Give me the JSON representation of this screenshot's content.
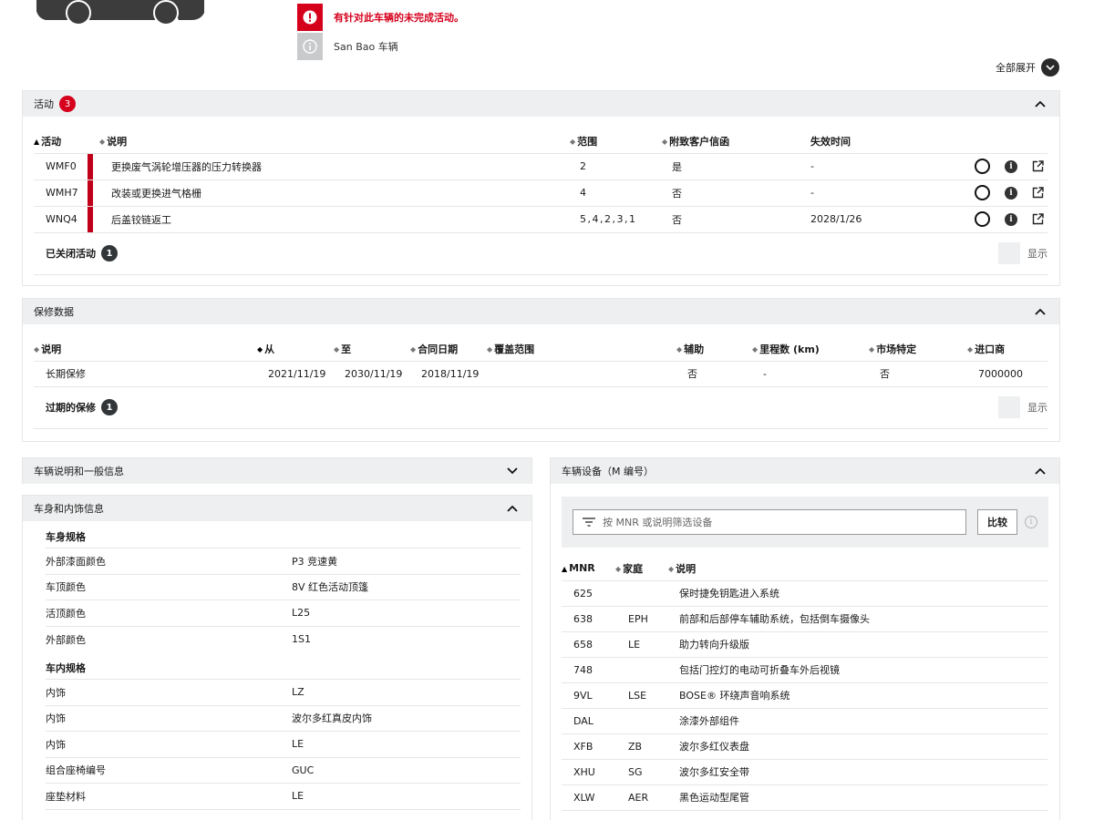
{
  "alerts": {
    "open_campaigns": "有针对此车辆的未完成活动。",
    "vehicle_type": "San Bao 车辆"
  },
  "expand_all": "全部展开",
  "campaigns": {
    "title": "活动",
    "count": "3",
    "headers": [
      "活动",
      "说明",
      "范围",
      "附致客户信函",
      "失效时间"
    ],
    "rows": [
      {
        "code": "WMF0",
        "desc": "更换废气涡轮增压器的压力转换器",
        "scope": "2",
        "letter": "是",
        "expiry": "-"
      },
      {
        "code": "WMH7",
        "desc": "改装或更换进气格栅",
        "scope": "4",
        "letter": "否",
        "expiry": "-"
      },
      {
        "code": "WNQ4",
        "desc": "后盖铰链返工",
        "scope": "5,4,2,3,1",
        "letter": "否",
        "expiry": "2028/1/26"
      }
    ],
    "closed_label": "已关闭活动",
    "closed_count": "1",
    "show_label": "显示"
  },
  "warranty": {
    "title": "保修数据",
    "headers": [
      "说明",
      "从",
      "至",
      "合同日期",
      "覆盖范围",
      "辅助",
      "里程数 (km)",
      "市场特定",
      "进口商"
    ],
    "rows": [
      {
        "desc": "长期保修",
        "from": "2021/11/19",
        "to": "2030/11/19",
        "contract": "2018/11/19",
        "coverage": "",
        "aux": "否",
        "mileage": "-",
        "market": "否",
        "importer": "7000000"
      }
    ],
    "expired_label": "过期的保修",
    "expired_count": "1",
    "show_label": "显示"
  },
  "general_info": {
    "title": "车辆说明和一般信息"
  },
  "body_interior": {
    "title": "车身和内饰信息",
    "body_spec_title": "车身规格",
    "body_spec": [
      {
        "k": "外部漆面颜色",
        "v": "P3 竞速黄"
      },
      {
        "k": "车顶颜色",
        "v": "8V 红色活动顶篷"
      },
      {
        "k": "活顶颜色",
        "v": "L25"
      },
      {
        "k": "外部颜色",
        "v": "1S1"
      }
    ],
    "interior_spec_title": "车内规格",
    "interior_spec": [
      {
        "k": "内饰",
        "v": "LZ"
      },
      {
        "k": "内饰",
        "v": "波尔多红真皮内饰"
      },
      {
        "k": "内饰",
        "v": "LE"
      },
      {
        "k": "组合座椅编号",
        "v": "GUC"
      },
      {
        "k": "座垫材料",
        "v": "LE"
      }
    ]
  },
  "equipment": {
    "title": "车辆设备（M 编号）",
    "filter_placeholder": "按 MNR 或说明筛选设备",
    "compare_label": "比较",
    "headers": [
      "MNR",
      "家庭",
      "说明"
    ],
    "rows": [
      {
        "mnr": "625",
        "family": "",
        "desc": "保时捷免钥匙进入系统"
      },
      {
        "mnr": "638",
        "family": "EPH",
        "desc": "前部和后部停车辅助系统，包括倒车摄像头"
      },
      {
        "mnr": "658",
        "family": "LE",
        "desc": "助力转向升级版"
      },
      {
        "mnr": "748",
        "family": "",
        "desc": "包括门控灯的电动可折叠车外后视镜"
      },
      {
        "mnr": "9VL",
        "family": "LSE",
        "desc": "BOSE® 环绕声音响系统"
      },
      {
        "mnr": "DAL",
        "family": "",
        "desc": "涂漆外部组件"
      },
      {
        "mnr": "XFB",
        "family": "ZB",
        "desc": "波尔多红仪表盘"
      },
      {
        "mnr": "XHU",
        "family": "SG",
        "desc": "波尔多红安全带"
      },
      {
        "mnr": "XLW",
        "family": "AER",
        "desc": "黑色运动型尾管"
      }
    ]
  }
}
